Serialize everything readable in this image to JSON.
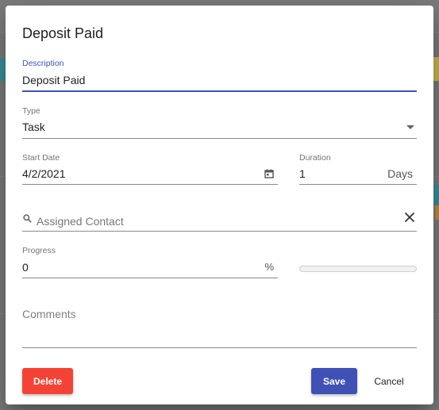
{
  "dialog": {
    "title": "Deposit Paid"
  },
  "fields": {
    "description": {
      "label": "Description",
      "value": "Deposit Paid"
    },
    "type": {
      "label": "Type",
      "value": "Task"
    },
    "start_date": {
      "label": "Start Date",
      "value": "4/2/2021"
    },
    "duration": {
      "label": "Duration",
      "value": "1",
      "unit": "Days"
    },
    "assigned_contact": {
      "placeholder": "Assigned Contact"
    },
    "progress": {
      "label": "Progress",
      "value": "0",
      "unit": "%",
      "bar_fraction": 0
    },
    "comments": {
      "placeholder": "Comments"
    }
  },
  "buttons": {
    "delete": "Delete",
    "save": "Save",
    "cancel": "Cancel"
  },
  "colors": {
    "accent": "#3f51b5",
    "danger": "#f44336",
    "backdrop": "#7c7c7c"
  },
  "icons": {
    "type_dropdown": "caret-down-icon",
    "start_date": "calendar-icon",
    "contact_search": "search-icon",
    "contact_clear": "close-icon"
  }
}
